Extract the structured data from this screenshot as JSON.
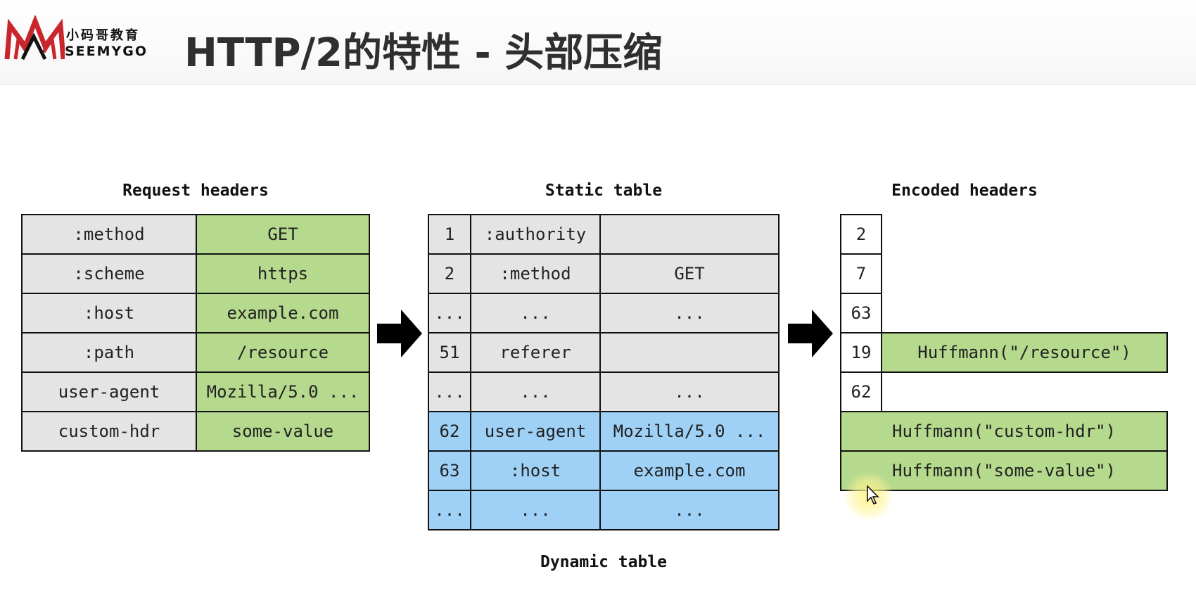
{
  "header": {
    "brand_cn": "小码哥教育",
    "brand_en": "SEEMYGO",
    "title": "HTTP/2的特性 - 头部压缩"
  },
  "request_headers": {
    "caption": "Request headers",
    "rows": [
      {
        "name": ":method",
        "value": "GET"
      },
      {
        "name": ":scheme",
        "value": "https"
      },
      {
        "name": ":host",
        "value": "example.com"
      },
      {
        "name": ":path",
        "value": "/resource"
      },
      {
        "name": "user-agent",
        "value": "Mozilla/5.0 ..."
      },
      {
        "name": "custom-hdr",
        "value": "some-value"
      }
    ]
  },
  "static_table": {
    "caption": "Static table",
    "rows": [
      {
        "index": "1",
        "name": ":authority",
        "value": ""
      },
      {
        "index": "2",
        "name": ":method",
        "value": "GET"
      },
      {
        "index": "...",
        "name": "...",
        "value": "..."
      },
      {
        "index": "51",
        "name": "referer",
        "value": ""
      },
      {
        "index": "...",
        "name": "...",
        "value": "..."
      }
    ]
  },
  "dynamic_table": {
    "caption": "Dynamic table",
    "rows": [
      {
        "index": "62",
        "name": "user-agent",
        "value": "Mozilla/5.0 ..."
      },
      {
        "index": "63",
        "name": ":host",
        "value": "example.com"
      },
      {
        "index": "...",
        "name": "...",
        "value": "..."
      }
    ]
  },
  "encoded_headers": {
    "caption": "Encoded headers",
    "rows": [
      {
        "index": "2",
        "literal": ""
      },
      {
        "index": "7",
        "literal": ""
      },
      {
        "index": "63",
        "literal": ""
      },
      {
        "index": "19",
        "literal": "Huffmann(\"/resource\")"
      },
      {
        "index": "62",
        "literal": ""
      },
      {
        "index": "",
        "literal": "Huffmann(\"custom-hdr\")"
      },
      {
        "index": "",
        "literal": "Huffmann(\"some-value\")"
      }
    ]
  },
  "colors": {
    "green": "#b5d98d",
    "grey": "#e4e4e4",
    "blue": "#9fd1f7",
    "border": "#111111"
  }
}
